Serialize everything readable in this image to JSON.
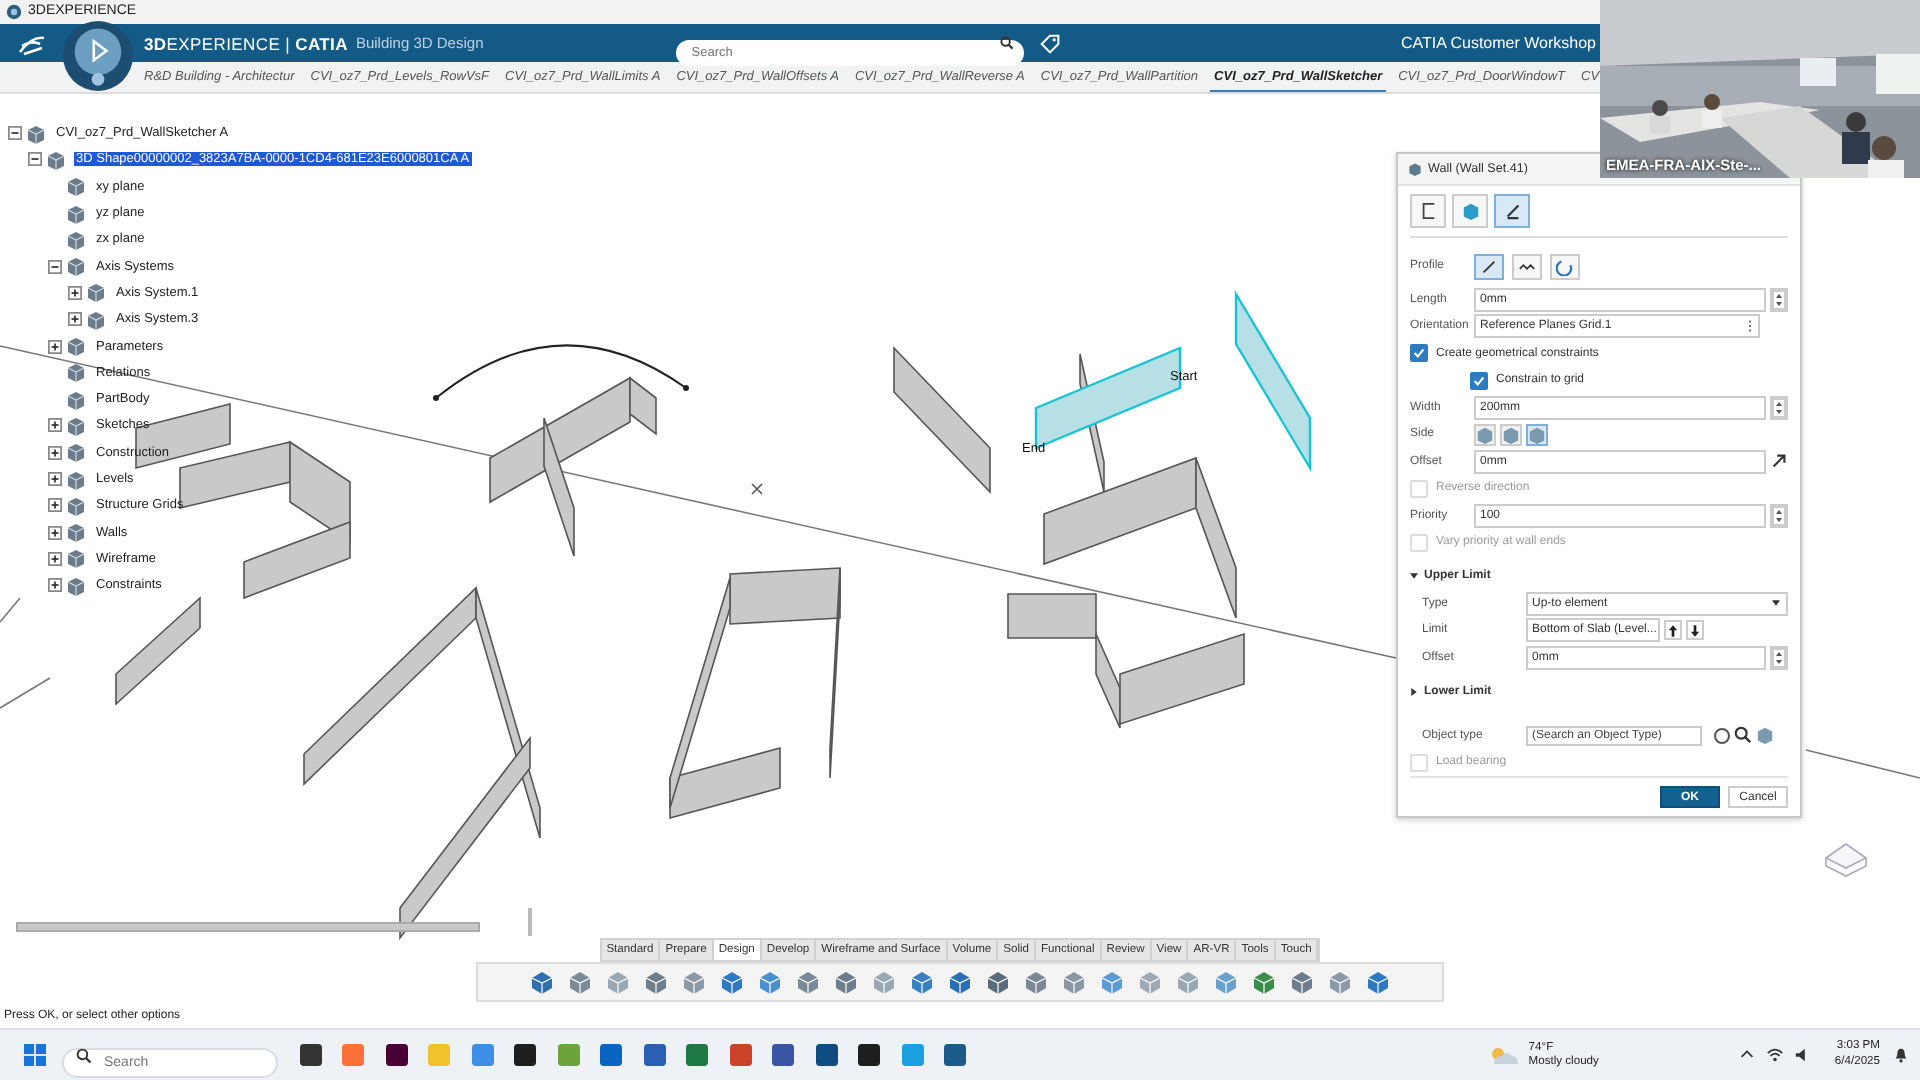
{
  "title_bar": {
    "title": "3DEXPERIENCE"
  },
  "header": {
    "brand": "**3D**EXPERIENCE | **CATIA**",
    "app": "Building 3D Design",
    "search": {
      "placeholder": "Search"
    },
    "workspace": "CATIA Customer Workshop"
  },
  "doc_tabs": [
    {
      "label": "R&D Building - Architectur",
      "selected": false
    },
    {
      "label": "CVI_oz7_Prd_Levels_RowVsF",
      "selected": false
    },
    {
      "label": "CVI_oz7_Prd_WallLimits A",
      "selected": false
    },
    {
      "label": "CVI_oz7_Prd_WallOffsets A",
      "selected": false
    },
    {
      "label": "CVI_oz7_Prd_WallReverse A",
      "selected": false
    },
    {
      "label": "CVI_oz7_Prd_WallPartition",
      "selected": false
    },
    {
      "label": "CVI_oz7_Prd_WallSketcher",
      "selected": true
    },
    {
      "label": "CVI_oz7_Prd_DoorWindowT",
      "selected": false
    },
    {
      "label": "CV",
      "selected": false
    }
  ],
  "tree": {
    "items": [
      {
        "label": "CVI_oz7_Prd_WallSketcher A",
        "expanded": true,
        "selected": false,
        "children": [
          {
            "label": "3D Shape00000002_3823A7BA-0000-1CD4-681E23E6000801CA A",
            "expanded": true,
            "selected": true,
            "children": [
              {
                "label": "xy plane",
                "selected": false
              },
              {
                "label": "yz plane",
                "selected": false
              },
              {
                "label": "zx plane",
                "selected": false
              },
              {
                "label": "Axis Systems",
                "expanded": true,
                "selected": false,
                "children": [
                  {
                    "label": "Axis System.1",
                    "expanded": false,
                    "selected": false
                  },
                  {
                    "label": "Axis System.3",
                    "expanded": false,
                    "selected": false
                  }
                ]
              },
              {
                "label": "Parameters",
                "expanded": false,
                "selected": false
              },
              {
                "label": "Relations",
                "selected": false
              },
              {
                "label": "PartBody",
                "selected": false
              },
              {
                "label": "Sketches",
                "expanded": false,
                "selected": false
              },
              {
                "label": "Construction",
                "expanded": false,
                "selected": false
              },
              {
                "label": "Levels",
                "expanded": false,
                "selected": false
              },
              {
                "label": "Structure Grids",
                "expanded": false,
                "selected": false
              },
              {
                "label": "Walls",
                "expanded": false,
                "selected": false
              },
              {
                "label": "Wireframe",
                "expanded": false,
                "selected": false
              },
              {
                "label": "Constraints",
                "expanded": false,
                "selected": false
              }
            ]
          }
        ]
      }
    ]
  },
  "canvas": {
    "start_label": "Start",
    "end_label": "End"
  },
  "dialog": {
    "title": "Wall (Wall Set.41)",
    "modes": [
      {
        "kind": "corner",
        "selected": false
      },
      {
        "kind": "solid",
        "selected": false
      },
      {
        "kind": "pencil",
        "selected": true
      }
    ],
    "profile": {
      "label": "Profile",
      "options": [
        {
          "kind": "line",
          "selected": true
        },
        {
          "kind": "wave",
          "selected": false
        },
        {
          "kind": "arc",
          "selected": false
        }
      ]
    },
    "rows": [
      {
        "kind": "spin",
        "label": "Length",
        "value": "0mm"
      },
      {
        "kind": "menu",
        "label": "Orientation",
        "value": "Reference Planes Grid.1"
      },
      {
        "kind": "check",
        "label": "Create geometrical constraints",
        "checked": true,
        "indented": false,
        "disabled": false
      },
      {
        "kind": "check",
        "label": "Constrain to grid",
        "checked": true,
        "indented": true,
        "disabled": false
      },
      {
        "kind": "spin",
        "label": "Width",
        "value": "200mm"
      },
      {
        "kind": "side",
        "label": "Side",
        "options": [
          {
            "selected": false
          },
          {
            "selected": false
          },
          {
            "selected": true
          }
        ]
      },
      {
        "kind": "pick",
        "label": "Offset",
        "value": "0mm"
      },
      {
        "kind": "check",
        "label": "Reverse direction",
        "checked": false,
        "indented": false,
        "disabled": true
      },
      {
        "kind": "spin",
        "label": "Priority",
        "value": "100"
      },
      {
        "kind": "check",
        "label": "Vary priority at wall ends",
        "checked": false,
        "indented": false,
        "disabled": true
      }
    ],
    "sections": [
      {
        "title": "Upper Limit",
        "expanded": true,
        "rows": [
          {
            "kind": "select",
            "label": "Type",
            "value": "Up-to element"
          },
          {
            "kind": "limit",
            "label": "Limit",
            "value": "Bottom of Slab (Level..."
          },
          {
            "kind": "spin",
            "label": "Offset",
            "value": "0mm"
          }
        ]
      },
      {
        "title": "Lower Limit",
        "expanded": false
      }
    ],
    "object_type": {
      "label": "Object type",
      "placeholder": "(Search an Object Type)",
      "radio_selected": false
    },
    "load_bearing": {
      "label": "Load bearing",
      "checked": false,
      "disabled": true
    },
    "buttons": [
      {
        "label": "OK",
        "kind": "primary"
      },
      {
        "label": "Cancel",
        "kind": "secondary"
      }
    ]
  },
  "video": {
    "caption": "EMEA-FRA-AIX-Ste-..."
  },
  "toolbar": {
    "sections": [
      {
        "label": "Standard",
        "selected": false
      },
      {
        "label": "Prepare",
        "selected": false
      },
      {
        "label": "Design",
        "selected": true
      },
      {
        "label": "Develop",
        "selected": false
      },
      {
        "label": "Wireframe and Surface",
        "selected": false
      },
      {
        "label": "Volume",
        "selected": false
      },
      {
        "label": "Solid",
        "selected": false
      },
      {
        "label": "Functional",
        "selected": false
      },
      {
        "label": "Review",
        "selected": false
      },
      {
        "label": "View",
        "selected": false
      },
      {
        "label": "AR-VR",
        "selected": false
      },
      {
        "label": "Tools",
        "selected": false
      },
      {
        "label": "Touch",
        "selected": false
      }
    ]
  },
  "status_bar": "Press OK, or select other options",
  "taskbar": {
    "search": {
      "placeholder": "Search"
    },
    "weather": {
      "temperature": "74°F",
      "condition": "Mostly cloudy"
    },
    "time": "3:03 PM",
    "date": "6/4/2025"
  }
}
